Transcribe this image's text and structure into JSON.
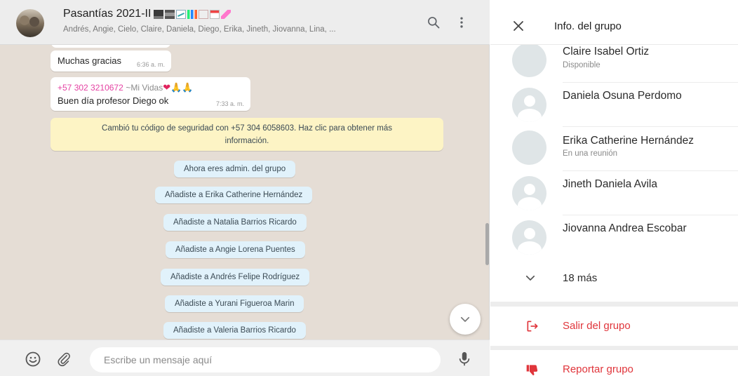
{
  "chat": {
    "group_name": "Pasantías 2021-II",
    "title_emoji_icons": [
      "laptop-emoji",
      "printer-emoji",
      "chart-increasing-emoji",
      "bar-chart-emoji",
      "clipboard-emoji",
      "calendar-emoji",
      "pencil-emoji"
    ],
    "members_line": "Andrés, Angie, Cielo, Claire, Daniela, Diego, Erika, Jineth, Jiovanna, Lina, ...",
    "header_icons": [
      "search-icon",
      "menu-dots-icon"
    ],
    "messages": [
      {
        "text": "Muchas gracias",
        "time": "6:36 a. m."
      },
      {
        "sender": "+57 302 3210672",
        "sender_alias": "~Mi Vidas",
        "alias_emojis": "❤🙏🙏",
        "text": "Buen día profesor Diego ok",
        "time": "7:33 a. m."
      }
    ],
    "security_notice": {
      "line1": "Cambió tu código de seguridad con +57 304 6058603. Haz clic para obtener más",
      "line2": "información."
    },
    "system_messages": [
      "Ahora eres admin. del grupo",
      "Añadiste a Erika Catherine Hernández",
      "Añadiste a Natalia Barrios Ricardo",
      "Añadiste a Angie Lorena Puentes",
      "Añadiste a Andrés Felipe Rodríguez",
      "Añadiste a Yurani Figueroa Marin",
      "Añadiste a Valeria Barrios Ricardo"
    ],
    "composer": {
      "placeholder": "Escribe un mensaje aquí",
      "icons": [
        "emoji-icon",
        "attach-icon",
        "microphone-icon"
      ]
    }
  },
  "info_panel": {
    "title": "Info. del grupo",
    "participants": [
      {
        "name": "Claire Isabel Ortiz",
        "status": "Disponible",
        "has_photo": true
      },
      {
        "name": "Daniela Osuna Perdomo",
        "status": "",
        "has_photo": false
      },
      {
        "name": "Erika Catherine Hernández",
        "status": "En una reunión",
        "has_photo": true
      },
      {
        "name": "Jineth Daniela Avila",
        "status": "",
        "has_photo": false
      },
      {
        "name": "Jiovanna Andrea Escobar",
        "status": "",
        "has_photo": false
      }
    ],
    "more_label": "18 más",
    "actions": [
      {
        "label": "Salir del grupo",
        "icon": "exit-icon"
      },
      {
        "label": "Reportar grupo",
        "icon": "thumbs-down-icon"
      }
    ],
    "accent_red": "#e0353b"
  }
}
